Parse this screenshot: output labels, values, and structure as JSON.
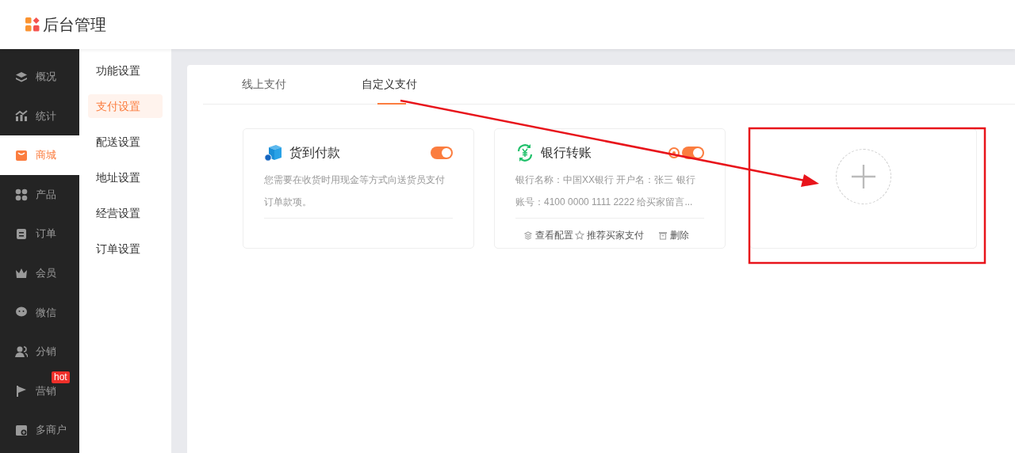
{
  "header": {
    "title": "后台管理"
  },
  "sidebar": {
    "items": [
      {
        "label": "概况",
        "selected": false
      },
      {
        "label": "统计",
        "selected": false
      },
      {
        "label": "商城",
        "selected": true
      },
      {
        "label": "产品",
        "selected": false
      },
      {
        "label": "订单",
        "selected": false
      },
      {
        "label": "会员",
        "selected": false
      },
      {
        "label": "微信",
        "selected": false
      },
      {
        "label": "分销",
        "selected": false
      },
      {
        "label": "营销",
        "selected": false,
        "badge": "hot"
      },
      {
        "label": "多商户",
        "selected": false
      }
    ]
  },
  "submenu": {
    "items": [
      {
        "label": "功能设置",
        "selected": false
      },
      {
        "label": "支付设置",
        "selected": true
      },
      {
        "label": "配送设置",
        "selected": false
      },
      {
        "label": "地址设置",
        "selected": false
      },
      {
        "label": "经营设置",
        "selected": false
      },
      {
        "label": "订单设置",
        "selected": false
      }
    ]
  },
  "tabs": [
    {
      "label": "线上支付",
      "selected": false
    },
    {
      "label": "自定义支付",
      "selected": true
    }
  ],
  "payment_methods": [
    {
      "kind": "method",
      "title": "货到付款",
      "on": true,
      "description": "您需要在收货时用现金等方式向送货员支付订单款项。"
    },
    {
      "kind": "method",
      "title": "银行转账",
      "on": true,
      "description": "银行名称：中国XX银行 开户名：张三 银行账号：4100 0000 1111 2222 给买家留言...",
      "actions": [
        "查看配置",
        "推荐买家支付",
        "删除"
      ]
    },
    {
      "kind": "add"
    }
  ]
}
